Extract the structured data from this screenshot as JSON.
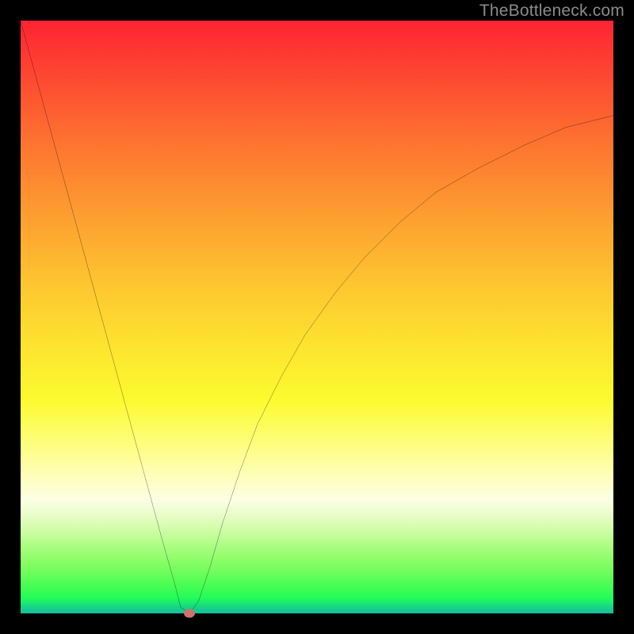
{
  "watermark": "TheBottleneck.com",
  "chart_data": {
    "type": "line",
    "title": "",
    "xlabel": "",
    "ylabel": "",
    "xlim": [
      0,
      100
    ],
    "ylim": [
      0,
      100
    ],
    "grid": false,
    "series": [
      {
        "name": "bottleneck-curve",
        "x": [
          0,
          3,
          6,
          9,
          12,
          15,
          18,
          21,
          24,
          26,
          27,
          28.5,
          30,
          32,
          34,
          37,
          40,
          44,
          48,
          53,
          58,
          64,
          70,
          77,
          85,
          92,
          100
        ],
        "y": [
          100,
          89,
          78,
          67,
          56,
          45,
          34,
          23,
          12,
          5,
          1,
          0,
          2,
          8,
          15,
          24,
          32,
          40,
          47,
          54,
          60,
          66,
          71,
          75,
          79,
          82,
          84
        ]
      }
    ],
    "marker": {
      "name": "sweet-spot",
      "x": 28.5,
      "y": 0,
      "color": "#cf736a"
    },
    "gradient_stops": [
      {
        "pct": 0,
        "color": "#fe2432"
      },
      {
        "pct": 55,
        "color": "#fde42f"
      },
      {
        "pct": 77,
        "color": "#fefebd"
      },
      {
        "pct": 100,
        "color": "#16bd9c"
      }
    ]
  }
}
